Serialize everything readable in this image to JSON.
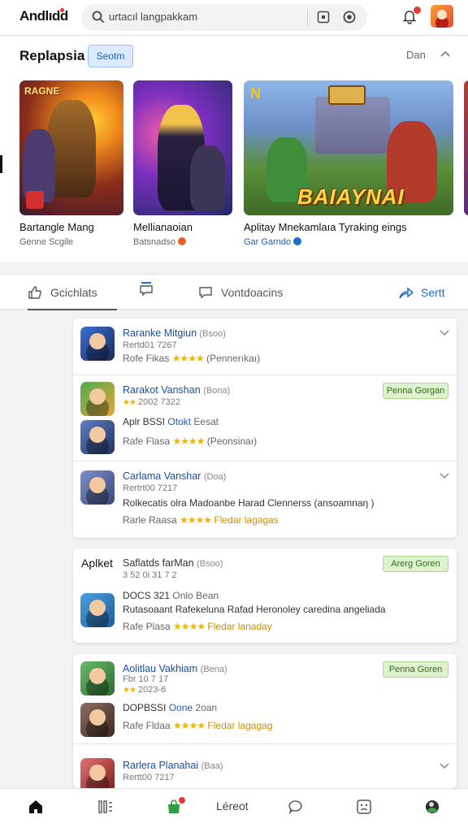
{
  "header": {
    "logo": "Andlıdd",
    "search_text": "urtacıl langpakkam",
    "colors": {
      "accent": "#1a6fd0",
      "badge": "#e53935"
    }
  },
  "featured": {
    "title": "Replapsia",
    "chip": "Seotm",
    "more": "Dan",
    "cards": [
      {
        "logo_text": "RAGNE",
        "title": "Bartangle Mang",
        "subtitle": "Genne Scgile"
      },
      {
        "title": "Mellianaoian",
        "subtitle": "Batsnadso"
      },
      {
        "banner_mark": "N",
        "banner_text": "BAIAYNAI",
        "title": "Aplitay Mnekamlaıa Tyraking eings",
        "subtitle": "Gar Garndo"
      }
    ]
  },
  "tabs": [
    {
      "label": "Gcichlats"
    },
    {
      "label": ""
    },
    {
      "label": "Vontdoacins"
    },
    {
      "label": "Sertt"
    }
  ],
  "list": {
    "g1": {
      "title": "Raranke Mitgiun",
      "title_sub": "(Bsoo)",
      "meta": "Rertd01 7267",
      "rate_label": "Rofe Fikas",
      "stars": "★★★★",
      "rate_sub": "(Pennerıkaı)"
    },
    "g2": {
      "title": "Rarakot Vanshan",
      "title_sub": "(Bona)",
      "meta": "2002 7322",
      "pill": "Penna Gorgan",
      "line2": "Aplr BSSI",
      "line2_blue": "Otokt",
      "line2_sub": "Eesat",
      "rate_label": "Rafe Flasa",
      "stars": "★★★★",
      "rate_sub": "(Peonsinaı)"
    },
    "g3": {
      "title": "Carlama Vanshar",
      "title_sub": "(Doa)",
      "meta": "Rertrt00 7217",
      "desc": "Rolkecatis olra Madoanbe Harad Clennerss (ansoamnaŋ )",
      "rate_label": "Rarle Raasa",
      "stars": "★★★★",
      "rate_sub": "Fledar lagagas"
    },
    "g4": {
      "brand": "Aplket",
      "title": "Saflatds farMan",
      "title_sub": "(Bsoo)",
      "meta": "3 52 0i 31 7 2",
      "pill": "Arerg Goren",
      "line2": "DOCS 321",
      "line2_blue": "Onlo",
      "line2_sub": "Bean",
      "desc": "Rutasoaant Rafekeluna Rafad Heronoley caredina angeliada",
      "rate_label": "Rafe Plasa",
      "stars": "★★★★",
      "rate_sub": "Fledar lanaday"
    },
    "g5": {
      "title": "Aolitlau Vakhiam",
      "title_sub": "(Bena)",
      "meta": "Fbr 10 7 17",
      "meta2": "2023-6",
      "pill": "Penna Goren",
      "line2": "DOPBSSI",
      "line2_blue": "Oone",
      "line2_sub": "2oan",
      "rate_label": "Rafe Fldaa",
      "stars": "★★★★",
      "rate_sub": "Fledar lagagag"
    },
    "g6": {
      "title": "Rarlera Planahai",
      "title_sub": "(Baa)",
      "meta": "Rertt00 7217"
    }
  },
  "bottom_nav": {
    "label": "Léreot",
    "icons": [
      "home-icon",
      "library-icon",
      "store-icon",
      "chat-icon",
      "emoji-icon",
      "profile-icon"
    ]
  }
}
